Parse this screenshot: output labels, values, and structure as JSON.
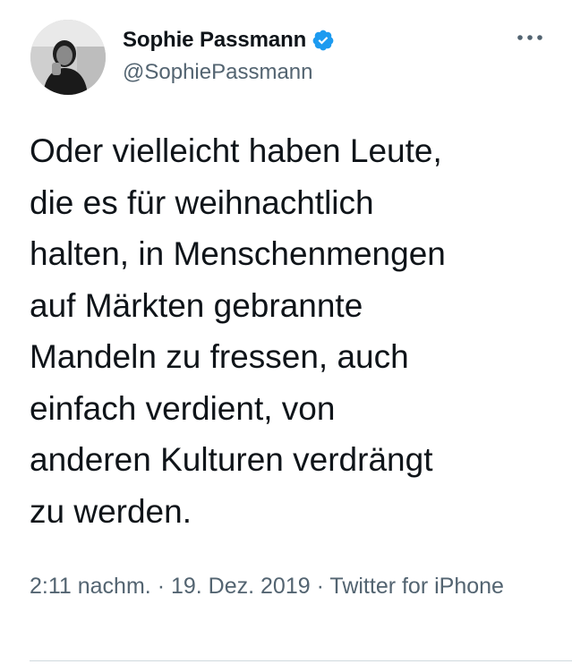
{
  "user": {
    "display_name": "Sophie Passmann",
    "handle": "@SophiePassmann",
    "verified_icon": "verified-badge-icon",
    "avatar": "profile-photo"
  },
  "tweet": {
    "text": "Oder vielleicht haben Leute,\ndie es für weihnachtlich\nhalten, in Menschenmengen\nauf Märkten gebrannte\nMandeln zu fressen, auch\neinfach verdient, von\nanderen Kulturen verdrängt\nzu werden.",
    "time": "2:11 nachm.",
    "separator": "·",
    "date": "19. Dez. 2019",
    "source": "Twitter for iPhone"
  },
  "icons": {
    "more": "more-options-icon"
  },
  "colors": {
    "accent": "#1d9bf0",
    "text": "#0f1419",
    "secondary": "#536471",
    "divider": "#cfd9de"
  }
}
